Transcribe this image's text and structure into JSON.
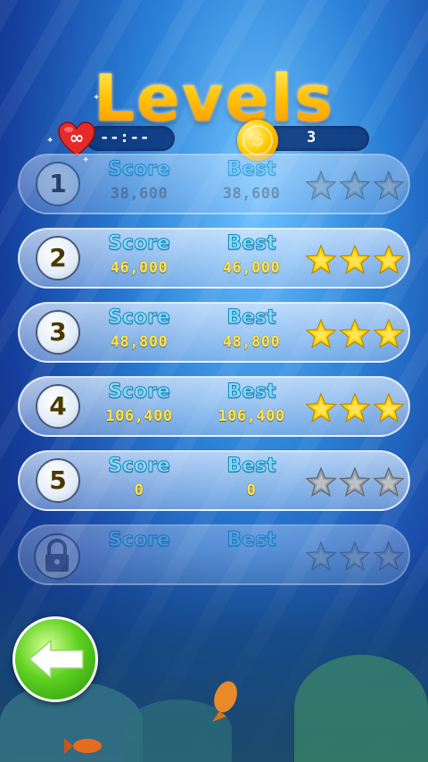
{
  "screen": {
    "title": "Levels"
  },
  "header": {
    "lives_timer": "--:--",
    "lives_icon": "heart-infinity-icon",
    "coins": "3",
    "coin_icon": "coin-icon"
  },
  "labels": {
    "score": "Score",
    "best": "Best"
  },
  "levels": [
    {
      "number": "1",
      "score": "38,600",
      "best": "38,600",
      "stars": 0,
      "state": "dim"
    },
    {
      "number": "2",
      "score": "46,000",
      "best": "46,000",
      "stars": 3,
      "state": "unlocked"
    },
    {
      "number": "3",
      "score": "48,800",
      "best": "48,800",
      "stars": 3,
      "state": "unlocked"
    },
    {
      "number": "4",
      "score": "106,400",
      "best": "106,400",
      "stars": 3,
      "state": "unlocked"
    },
    {
      "number": "5",
      "score": "0",
      "best": "0",
      "stars": 0,
      "state": "unlocked"
    },
    {
      "number": "",
      "score": "",
      "best": "",
      "stars": 0,
      "state": "locked"
    }
  ],
  "back_button": {
    "icon": "arrow-left-icon"
  },
  "colors": {
    "star_gold": "#ffd400",
    "star_gray": "#9aa0a8",
    "label_cyan": "#7fe3ff",
    "value_gold": "#ffe44d",
    "back_green": "#5ed11f"
  }
}
